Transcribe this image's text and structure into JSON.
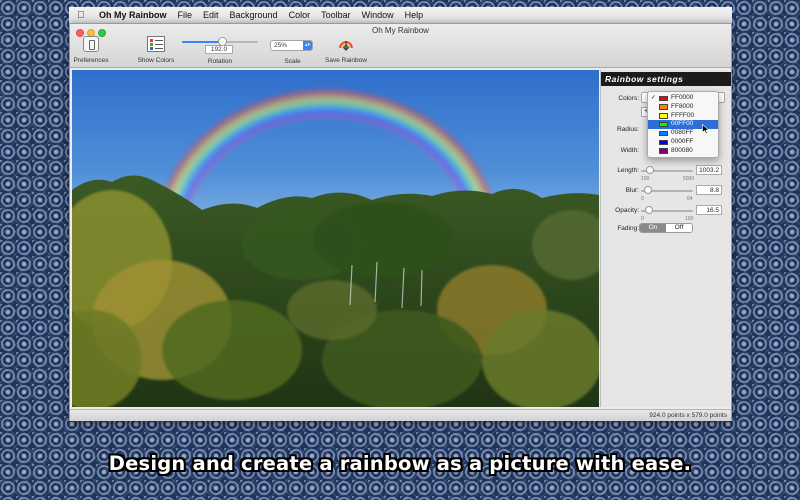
{
  "menubar": {
    "app_name": "Oh My Rainbow",
    "items": [
      "File",
      "Edit",
      "Background",
      "Color",
      "Toolbar",
      "Window",
      "Help"
    ]
  },
  "window": {
    "title": "Oh My Rainbow"
  },
  "toolbar": {
    "preferences_label": "Preferences",
    "show_colors_label": "Show Colors",
    "rotation_label": "Rotation",
    "rotation_value": "192.0",
    "rotation_fraction": 0.53,
    "scale_label": "Scale",
    "scale_value": "25%",
    "save_label": "Save Rainbow"
  },
  "panel": {
    "title": "Rainbow settings",
    "colors_label": "Colors:",
    "add_label": "+",
    "radius_label": "Radius:",
    "width_label": "Width:",
    "length_label": "Length:",
    "length_min": "100",
    "length_max": "5000",
    "length_value": "1003.2",
    "length_fraction": 0.18,
    "blur_label": "Blur:",
    "blur_min": "0",
    "blur_max": "64",
    "blur_value": "8.8",
    "blur_fraction": 0.14,
    "opacity_label": "Opacity:",
    "opacity_min": "0",
    "opacity_max": "100",
    "opacity_value": "16.5",
    "opacity_fraction": 0.16,
    "fading_label": "Fading:",
    "fading_on": "On",
    "fading_off": "Off"
  },
  "colors_dropdown": {
    "items": [
      {
        "label": "FF0000",
        "color": "#FF0000",
        "checked": true,
        "selected": false
      },
      {
        "label": "FF8000",
        "color": "#FF8000",
        "checked": false,
        "selected": false
      },
      {
        "label": "FFFF00",
        "color": "#FFFF00",
        "checked": false,
        "selected": false
      },
      {
        "label": "00FF00",
        "color": "#00FF00",
        "checked": false,
        "selected": true
      },
      {
        "label": "0080FF",
        "color": "#0080FF",
        "checked": false,
        "selected": false
      },
      {
        "label": "0000FF",
        "color": "#0000FF",
        "checked": false,
        "selected": false
      },
      {
        "label": "800080",
        "color": "#800080",
        "checked": false,
        "selected": false
      }
    ]
  },
  "status": {
    "text": "924.0 points x 579.0 points"
  },
  "caption": {
    "text": "Design and create a rainbow as a picture with ease."
  },
  "colors": {
    "accent": "#3A84F3",
    "panel_header": "#1B1B1B"
  }
}
